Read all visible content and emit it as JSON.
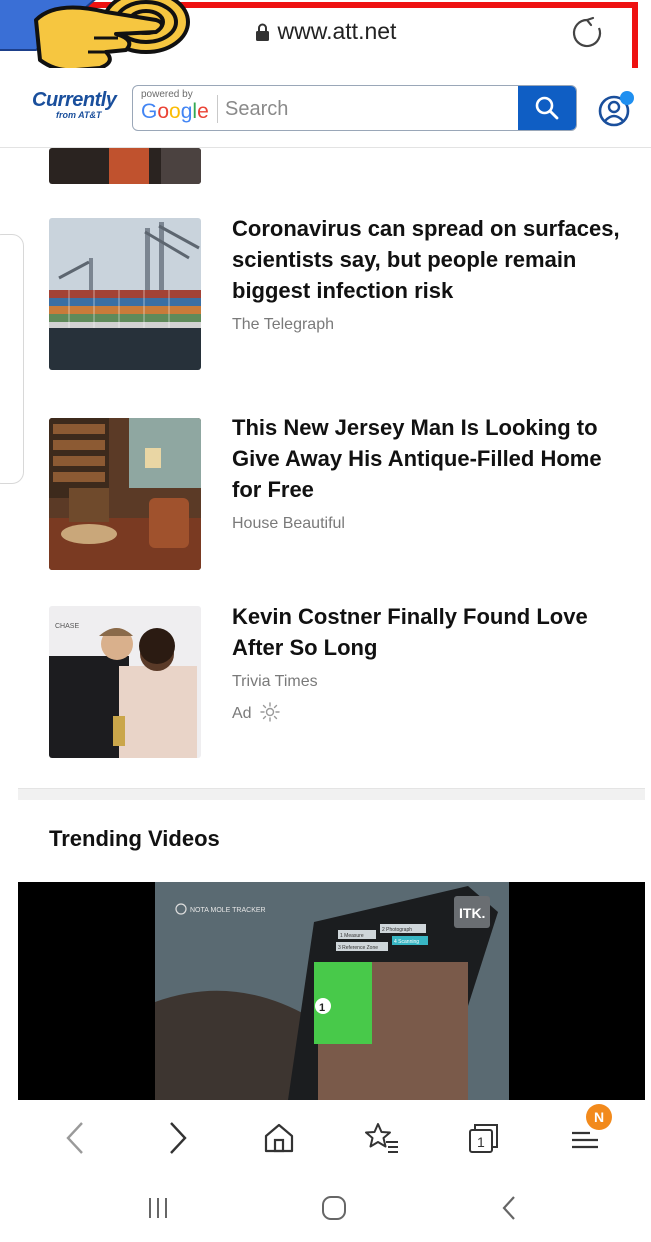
{
  "browser": {
    "url": "www.att.net"
  },
  "header": {
    "logo_main": "Currently",
    "logo_sub": "from AT&T",
    "powered_by": "powered by",
    "google_letters": [
      "G",
      "o",
      "o",
      "g",
      "l",
      "e"
    ],
    "search_placeholder": "Search"
  },
  "articles": [
    {
      "title": "Coronavirus can spread on surfaces, scientists say, but people remain biggest infection risk",
      "source": "The Telegraph"
    },
    {
      "title": "This New Jersey Man Is Looking to Give Away His Antique-Filled Home for Free",
      "source": "House Beautiful"
    },
    {
      "title": "Kevin Costner Finally Found Love After So Long",
      "source": "Trivia Times",
      "ad_label": "Ad"
    }
  ],
  "trending": {
    "title": "Trending Videos",
    "video_overlay_text": "NOTA MOLE TRACKER",
    "video_logo": "ITK.",
    "video_number": "1",
    "video_chips": [
      "1 Measure",
      "2 Photograph",
      "3 Reference Zone",
      "4 Scanning"
    ]
  },
  "browser_nav": {
    "tab_count": "1",
    "menu_badge": "N"
  },
  "colors": {
    "brand_blue": "#1a4f9c",
    "search_button": "#0f5ec4",
    "highlight": "#ee1111",
    "badge": "#f28a1c",
    "avatar_dot": "#1f8ff0"
  }
}
